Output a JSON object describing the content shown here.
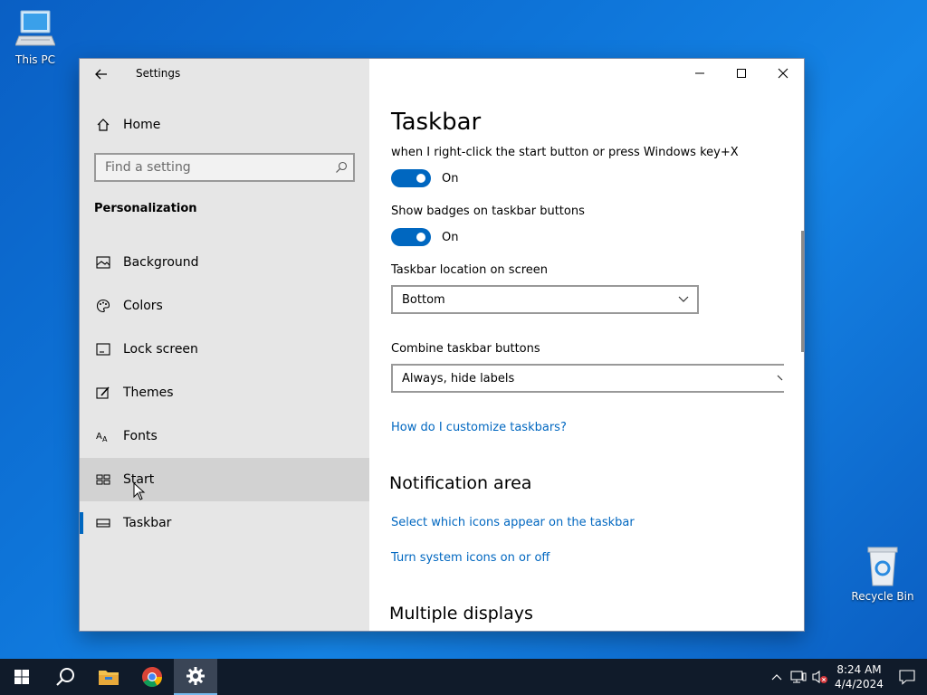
{
  "desktop": {
    "this_pc_label": "This PC",
    "recycle_bin_label": "Recycle Bin"
  },
  "window": {
    "app_title": "Settings",
    "back_icon": "back-arrow-icon",
    "controls": {
      "minimize_icon": "minimize-icon",
      "maximize_icon": "maximize-icon",
      "close_icon": "close-icon"
    }
  },
  "sidebar": {
    "home_label": "Home",
    "search_placeholder": "Find a setting",
    "section_heading": "Personalization",
    "items": [
      {
        "label": "Background",
        "icon": "picture-icon"
      },
      {
        "label": "Colors",
        "icon": "palette-icon"
      },
      {
        "label": "Lock screen",
        "icon": "lock-screen-icon"
      },
      {
        "label": "Themes",
        "icon": "themes-icon"
      },
      {
        "label": "Fonts",
        "icon": "fonts-icon"
      },
      {
        "label": "Start",
        "icon": "start-layout-icon"
      },
      {
        "label": "Taskbar",
        "icon": "taskbar-icon"
      }
    ],
    "hovered_item": "Start",
    "selected_item": "Taskbar"
  },
  "main": {
    "title": "Taskbar",
    "partial_setting_text": "when I right-click the start button or press Windows key+X",
    "toggle1": {
      "state_label": "On",
      "on": true
    },
    "badges_label": "Show badges on taskbar buttons",
    "toggle2": {
      "state_label": "On",
      "on": true
    },
    "location_label": "Taskbar location on screen",
    "location_value": "Bottom",
    "combine_label": "Combine taskbar buttons",
    "combine_value": "Always, hide labels",
    "customize_link": "How do I customize taskbars?",
    "notification_heading": "Notification area",
    "select_icons_link": "Select which icons appear on the taskbar",
    "system_icons_link": "Turn system icons on or off",
    "multiple_displays_heading": "Multiple displays"
  },
  "taskbar": {
    "time": "8:24 AM",
    "date": "4/4/2024",
    "apps": [
      "start-icon",
      "search-icon",
      "file-explorer-icon",
      "chrome-icon",
      "settings-gear-icon"
    ],
    "active_app": "settings-gear-icon",
    "tray_icons": [
      "chevron-up-icon",
      "network-icon",
      "volume-muted-icon"
    ]
  },
  "colors": {
    "accent": "#0067c0",
    "sidebar_bg": "#e6e6e6",
    "taskbar_bg": "#101b2a"
  }
}
